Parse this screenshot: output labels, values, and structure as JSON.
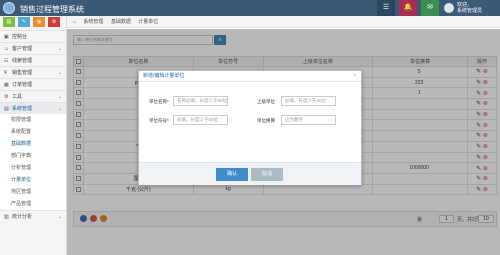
{
  "app": {
    "title": "销售过程管理系统"
  },
  "topbar": {
    "badges": [
      "2",
      "4",
      "2"
    ],
    "user_greeting": "欢迎，",
    "user_name": "系统管理员"
  },
  "sidebar": {
    "items": [
      {
        "icon": "dashboard-icon",
        "label": "控制台"
      },
      {
        "icon": "users-icon",
        "label": "客户管理"
      },
      {
        "icon": "clues-icon",
        "label": "线索管理"
      },
      {
        "icon": "sales-icon",
        "label": "销售管理"
      },
      {
        "icon": "order-icon",
        "label": "订单管理"
      },
      {
        "icon": "tools-icon",
        "label": "工具"
      },
      {
        "icon": "settings-icon",
        "label": "系统管理"
      }
    ],
    "sub_items": [
      "权限管理",
      "系统配置",
      "基础数据",
      "部门字典",
      "分析管理",
      "计量单位",
      "地区管理",
      "产品管理"
    ],
    "bottom_item": {
      "icon": "stats-icon",
      "label": "统计分析"
    }
  },
  "breadcrumb": [
    "系统管理",
    "基础数据",
    "计量单位"
  ],
  "search": {
    "placeholder": "输入单位名称关键字"
  },
  "table": {
    "headers": [
      "单位名称",
      "单位符号",
      "上级单位名称",
      "单位换算",
      "操作"
    ],
    "rows": [
      {
        "name": "",
        "symbol": "",
        "parent": "",
        "ratio": "5"
      },
      {
        "name": "pro",
        "symbol": "",
        "parent": "",
        "ratio": "223"
      },
      {
        "name": "",
        "symbol": "",
        "parent": "",
        "ratio": "1"
      },
      {
        "name": "",
        "symbol": "",
        "parent": "",
        "ratio": ""
      },
      {
        "name": "",
        "symbol": "",
        "parent": "",
        "ratio": ""
      },
      {
        "name": "",
        "symbol": "",
        "parent": "",
        "ratio": ""
      },
      {
        "name": "",
        "symbol": "",
        "parent": "",
        "ratio": ""
      },
      {
        "name": "千",
        "symbol": "",
        "parent": "",
        "ratio": ""
      },
      {
        "name": "",
        "symbol": "",
        "parent": "",
        "ratio": ""
      },
      {
        "name": "",
        "symbol": "",
        "parent": "",
        "ratio": "1000000"
      },
      {
        "name": "厘米",
        "symbol": "",
        "parent": "",
        "ratio": ""
      },
      {
        "name": "千克 (公斤)",
        "symbol": "kg",
        "parent": "",
        "ratio": ""
      }
    ]
  },
  "pager": {
    "label_page": "第",
    "current": "1",
    "total_label": "页，共2页",
    "page_size": "10"
  },
  "modal": {
    "title": "新增/编辑计量单位",
    "fields": [
      {
        "label": "单位名称*",
        "placeholder": "名称必填，长度少于50位"
      },
      {
        "label": "上级单位",
        "placeholder": "必填，长度少于50位"
      },
      {
        "label": "单位符号*",
        "placeholder": "必填，长度少于50位"
      },
      {
        "label": "单位换算",
        "placeholder": "应为数字"
      }
    ],
    "ok": "确认",
    "cancel": "取消"
  },
  "colors": {
    "topbar": "#3a5a78",
    "primary": "#428bca",
    "danger": "#d9534f"
  }
}
